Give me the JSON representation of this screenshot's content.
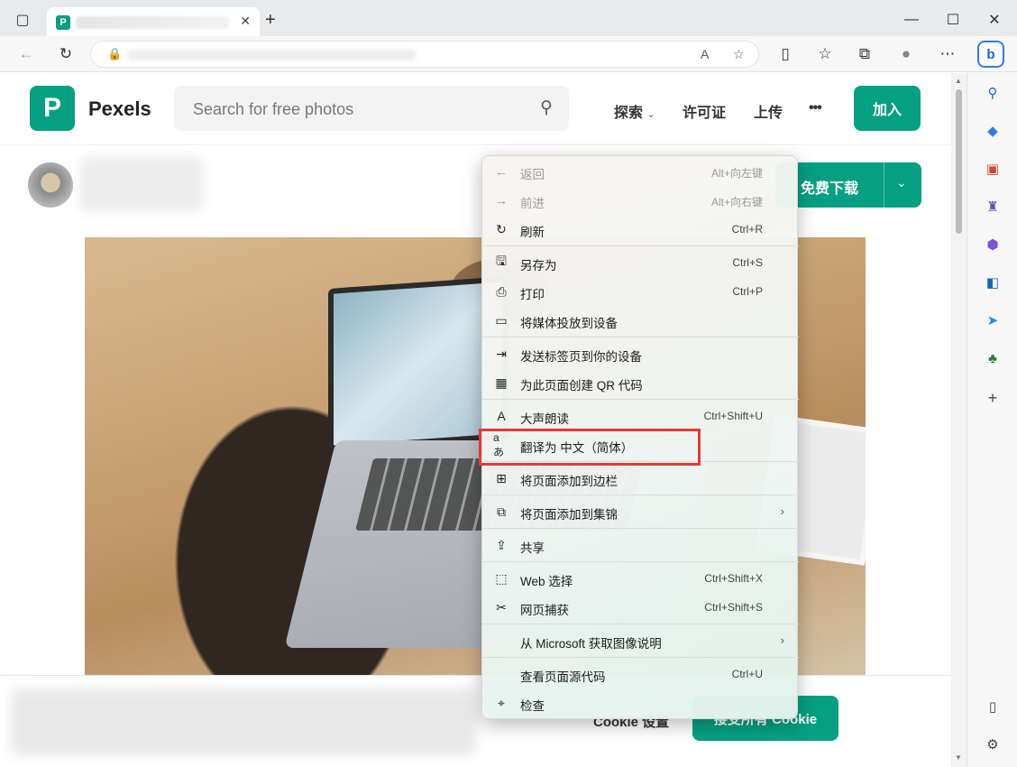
{
  "browser": {
    "tab_close": "✕",
    "new_tab": "+",
    "window_controls": {
      "minimize": "—",
      "maximize": "☐",
      "close": "✕"
    },
    "nav": {
      "back": "←",
      "refresh": "↻"
    },
    "bing": "b"
  },
  "site": {
    "logo_letter": "P",
    "logo_text": "Pexels",
    "search_placeholder": "Search for free photos",
    "nav": {
      "explore": "探索",
      "license": "许可证",
      "upload": "上传",
      "more": "•••"
    },
    "join": "加入",
    "download": "免费下载",
    "cookie_settings": "Cookie 设置",
    "cookie_accept": "接受所有 Cookie"
  },
  "context_menu": {
    "items": [
      {
        "label": "返回",
        "shortcut": "Alt+向左键",
        "icon": "arrow-left-icon",
        "glyph": "←"
      },
      {
        "label": "前进",
        "shortcut": "Alt+向右键",
        "icon": "arrow-right-icon",
        "glyph": "→"
      },
      {
        "label": "刷新",
        "shortcut": "Ctrl+R",
        "icon": "refresh-icon",
        "glyph": "↻"
      },
      {
        "label": "另存为",
        "shortcut": "Ctrl+S",
        "icon": "save-icon",
        "glyph": "🖫"
      },
      {
        "label": "打印",
        "shortcut": "Ctrl+P",
        "icon": "print-icon",
        "glyph": "⎙"
      },
      {
        "label": "将媒体投放到设备",
        "shortcut": "",
        "icon": "cast-icon",
        "glyph": "▭"
      },
      {
        "label": "发送标签页到你的设备",
        "shortcut": "",
        "icon": "send-tab-icon",
        "glyph": "⇥"
      },
      {
        "label": "为此页面创建 QR 代码",
        "shortcut": "",
        "icon": "qr-code-icon",
        "glyph": "▦"
      },
      {
        "label": "大声朗读",
        "shortcut": "Ctrl+Shift+U",
        "icon": "read-aloud-icon",
        "glyph": "A"
      },
      {
        "label": "翻译为 中文（简体）",
        "shortcut": "",
        "icon": "translate-icon",
        "glyph": "aあ"
      },
      {
        "label": "将页面添加到边栏",
        "shortcut": "",
        "icon": "add-sidebar-icon",
        "glyph": "⊞"
      },
      {
        "label": "将页面添加到集锦",
        "shortcut": "",
        "icon": "collections-icon",
        "glyph": "⧉"
      },
      {
        "label": "共享",
        "shortcut": "",
        "icon": "share-icon",
        "glyph": "⇪"
      },
      {
        "label": "Web 选择",
        "shortcut": "Ctrl+Shift+X",
        "icon": "web-select-icon",
        "glyph": "⬚"
      },
      {
        "label": "网页捕获",
        "shortcut": "Ctrl+Shift+S",
        "icon": "web-capture-icon",
        "glyph": "✂"
      },
      {
        "label": "从 Microsoft 获取图像说明",
        "shortcut": "",
        "icon": "",
        "glyph": ""
      },
      {
        "label": "查看页面源代码",
        "shortcut": "Ctrl+U",
        "icon": "",
        "glyph": ""
      },
      {
        "label": "检查",
        "shortcut": "",
        "icon": "inspect-icon",
        "glyph": "⌖"
      }
    ],
    "submenu_arrow": "›"
  },
  "colors": {
    "brand": "#05a081",
    "highlight": "#e53935"
  }
}
